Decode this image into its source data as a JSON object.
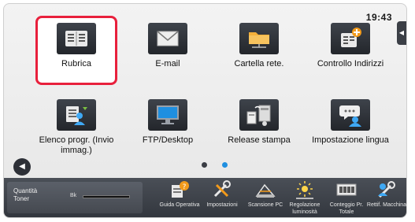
{
  "status": {
    "time": "19:43"
  },
  "tiles": [
    {
      "label": "Rubrica",
      "icon": "address-book-icon",
      "selected": true
    },
    {
      "label": "E-mail",
      "icon": "envelope-icon"
    },
    {
      "label": "Cartella rete.",
      "icon": "network-folder-icon"
    },
    {
      "label": "Controllo Indirizzi",
      "icon": "address-check-icon"
    },
    {
      "label": "Elenco progr. (Invio immag.)",
      "icon": "program-list-icon"
    },
    {
      "label": "FTP/Desktop",
      "icon": "monitor-icon"
    },
    {
      "label": "Release stampa",
      "icon": "print-release-icon"
    },
    {
      "label": "Impostazione lingua",
      "icon": "language-icon"
    }
  ],
  "pager": {
    "pages": 2,
    "current": 2
  },
  "toner": {
    "label": "Quantità Toner",
    "color_code": "Bk"
  },
  "bottom_bar": [
    {
      "label": "Guida Operativa",
      "icon": "help-guide-icon"
    },
    {
      "label": "Impostazioni",
      "icon": "tools-icon"
    },
    {
      "label": "Scansione PC",
      "icon": "scan-pc-icon"
    },
    {
      "label": "Regolazione luminosità",
      "icon": "brightness-icon"
    },
    {
      "label": "Conteggio Pr. Totale",
      "icon": "counter-icon"
    },
    {
      "label": "Rettif. Macchina",
      "icon": "machine-adjust-icon"
    }
  ],
  "colors": {
    "selection": "#e8203c",
    "pager_active": "#1f8fe0",
    "accent_orange": "#f29a1a"
  }
}
